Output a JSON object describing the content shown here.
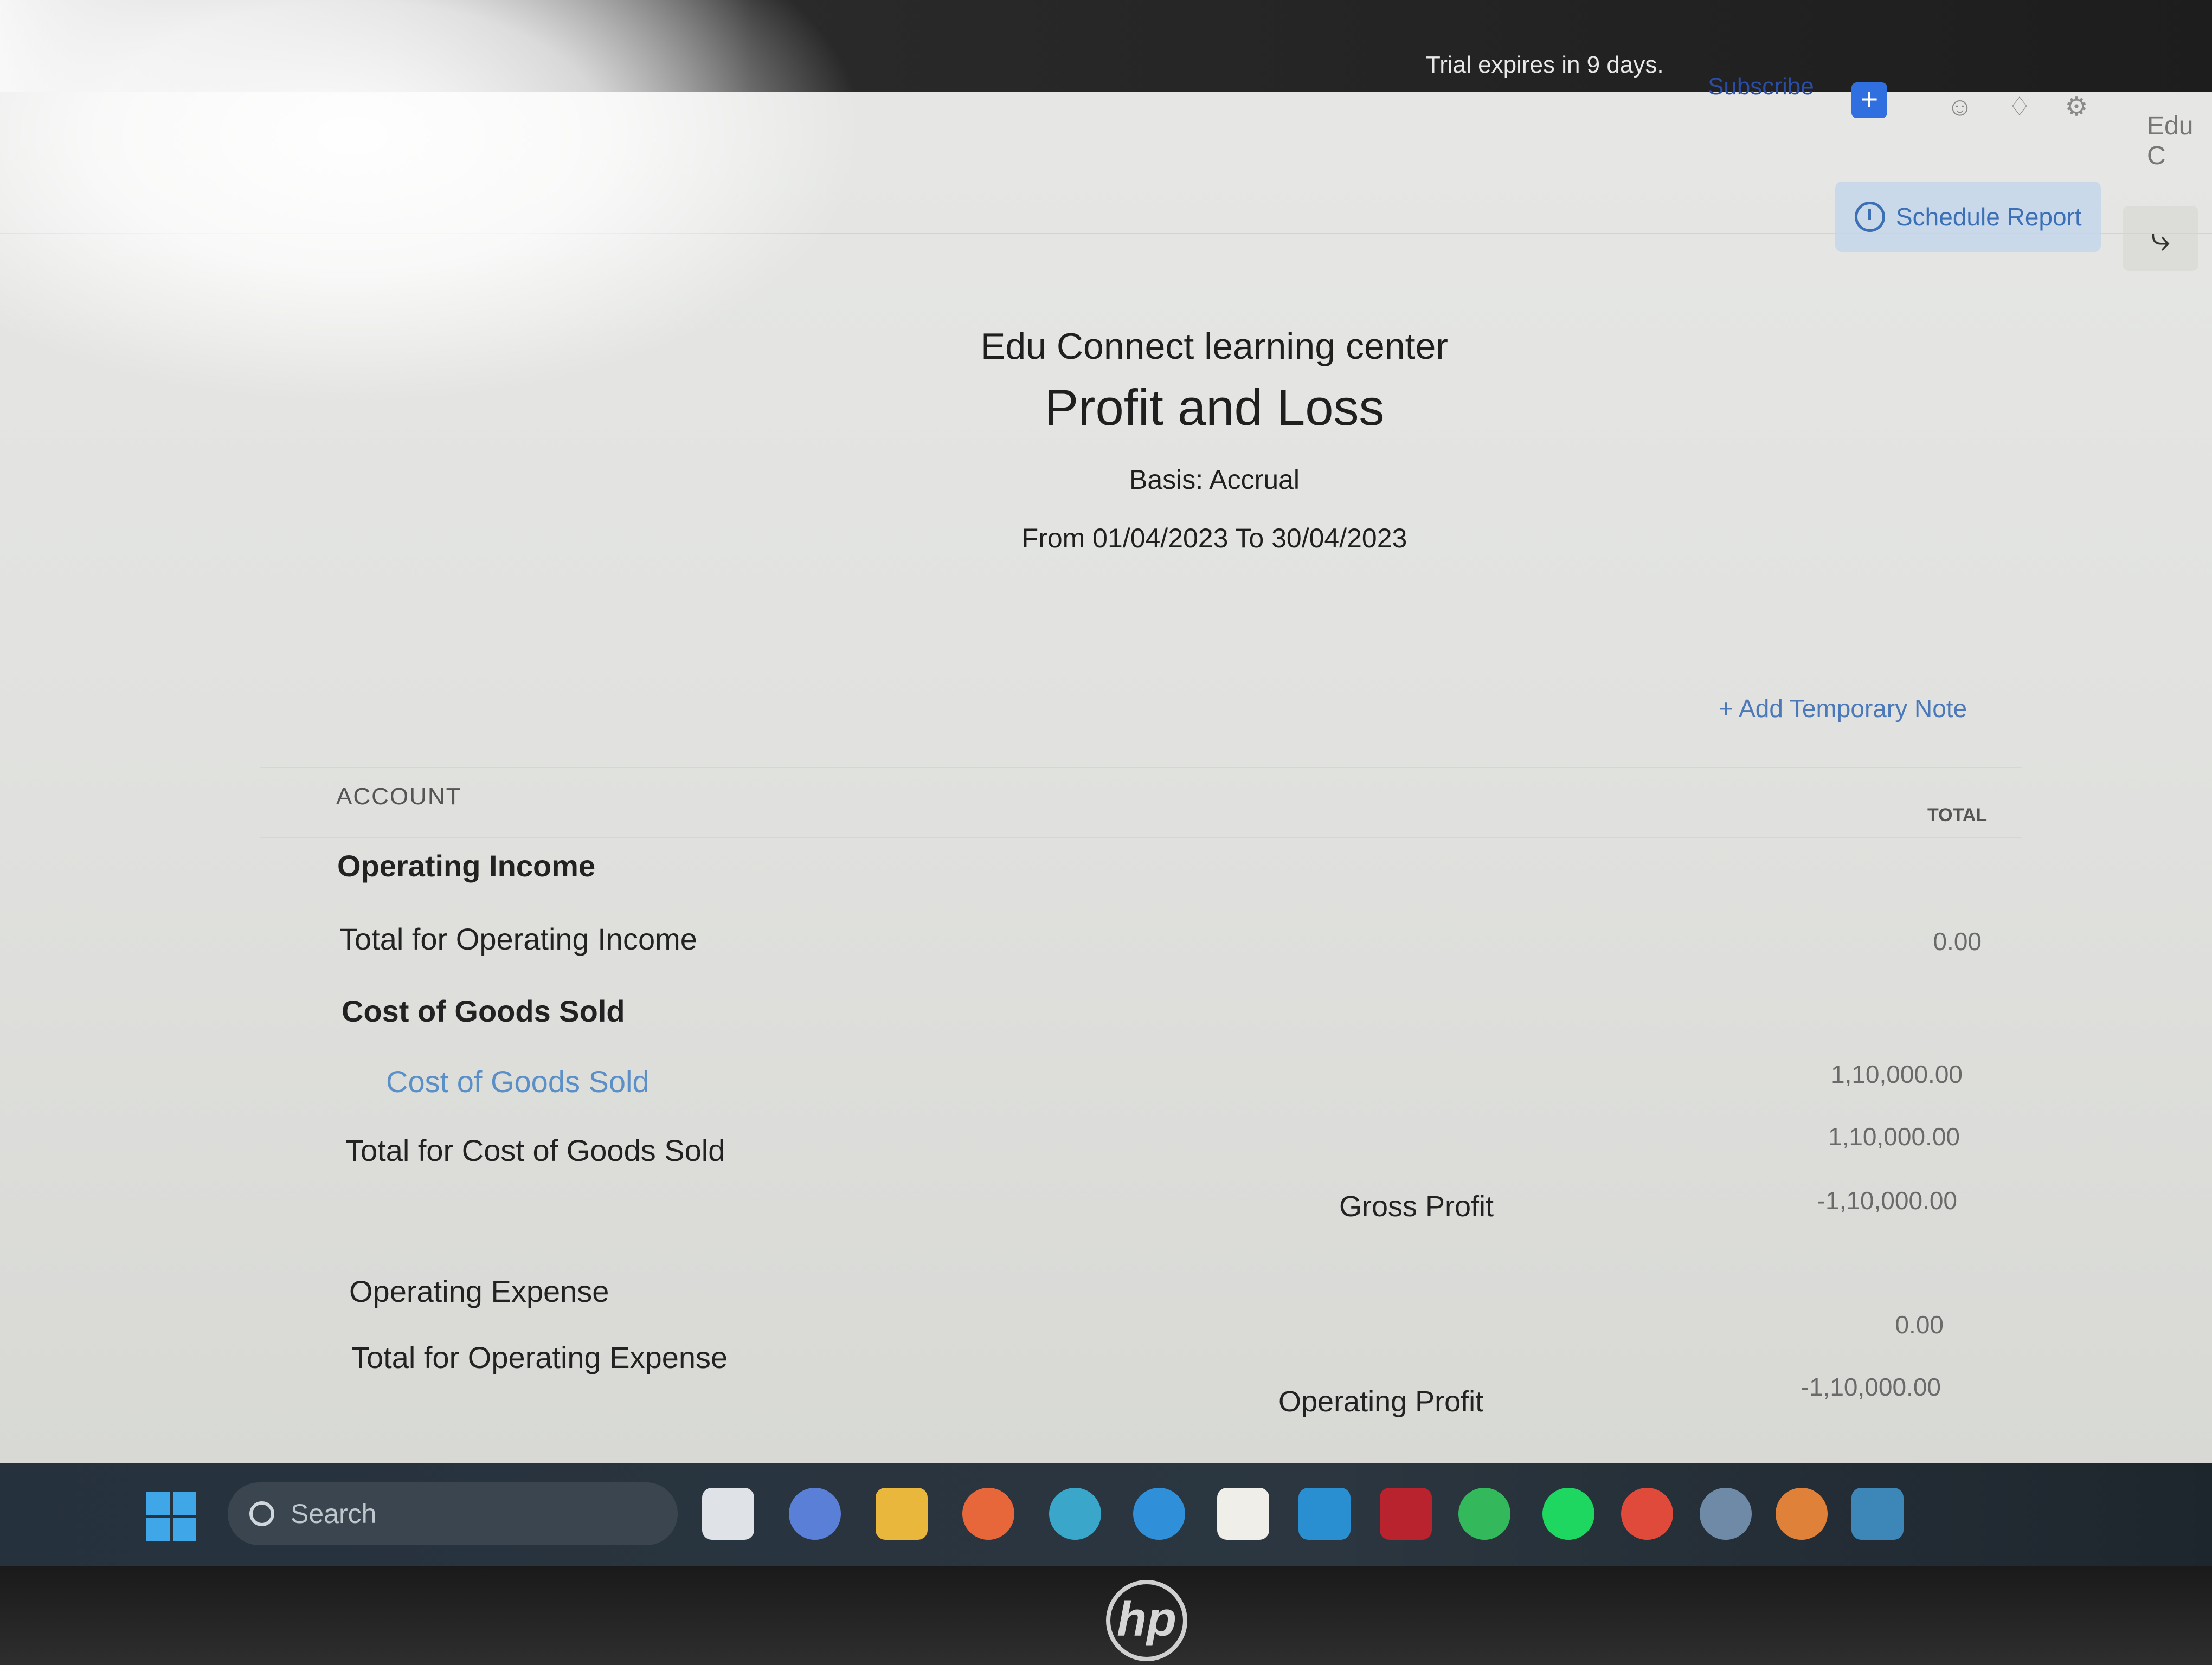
{
  "topbar": {
    "trial_text": "Trial expires in 9 days.",
    "subscribe_label": "Subscribe",
    "add_label": "+",
    "user_name": "Edu C"
  },
  "toolbar": {
    "schedule_report_label": "Schedule Report"
  },
  "report": {
    "company": "Edu Connect learning center",
    "title": "Profit and Loss",
    "basis": "Basis: Accrual",
    "period": "From 01/04/2023 To 30/04/2023",
    "add_note_label": "+ Add Temporary Note",
    "columns": {
      "account": "ACCOUNT",
      "total": "TOTAL"
    },
    "rows": [
      {
        "label": "Operating Income",
        "amount": ""
      },
      {
        "label": "Total for Operating Income",
        "amount": "0.00"
      },
      {
        "label": "Cost of Goods Sold",
        "amount": ""
      },
      {
        "label": "Cost of Goods Sold",
        "amount": "1,10,000.00"
      },
      {
        "label": "Total for Cost of Goods Sold",
        "amount": "1,10,000.00"
      },
      {
        "label": "Gross Profit",
        "amount": "-1,10,000.00"
      },
      {
        "label": "Operating Expense",
        "amount": ""
      },
      {
        "label": "Total for Operating Expense",
        "amount": "0.00"
      },
      {
        "label": "Operating Profit",
        "amount": "-1,10,000.00"
      }
    ]
  },
  "taskbar": {
    "search_placeholder": "Search",
    "apps": [
      "task-view",
      "chat",
      "file-explorer",
      "firefox",
      "get-help",
      "edge",
      "microsoft-store",
      "azure",
      "antivirus",
      "whatsapp",
      "spotify",
      "chrome",
      "settings",
      "chrome-profile",
      "remote-desktop"
    ]
  },
  "brand": "hp"
}
